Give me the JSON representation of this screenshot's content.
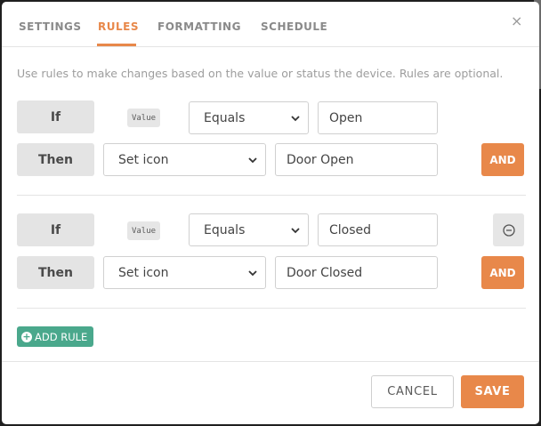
{
  "tabs": [
    {
      "label": "SETTINGS",
      "active": false
    },
    {
      "label": "RULES",
      "active": true
    },
    {
      "label": "FORMATTING",
      "active": false
    },
    {
      "label": "SCHEDULE",
      "active": false
    }
  ],
  "close_symbol": "×",
  "description": "Use rules to make changes based on the value or status the device. Rules are optional.",
  "rules": [
    {
      "if_label": "If",
      "value_tag": "Value",
      "operator": "Equals",
      "compare_value": "Open",
      "then_label": "Then",
      "action": "Set icon",
      "action_value": "Door Open",
      "and_label": "AND"
    },
    {
      "if_label": "If",
      "value_tag": "Value",
      "operator": "Equals",
      "compare_value": "Closed",
      "then_label": "Then",
      "action": "Set icon",
      "action_value": "Door Closed",
      "and_label": "AND"
    }
  ],
  "add_rule_label": "ADD RULE",
  "footer": {
    "cancel_label": "CANCEL",
    "save_label": "SAVE"
  },
  "colors": {
    "accent": "#e8884a",
    "add_rule": "#4aa88c"
  },
  "icons": {
    "close": "close-icon",
    "chevron": "chevron-down-icon",
    "remove": "minus-circle-icon",
    "add": "plus-circle-icon"
  }
}
